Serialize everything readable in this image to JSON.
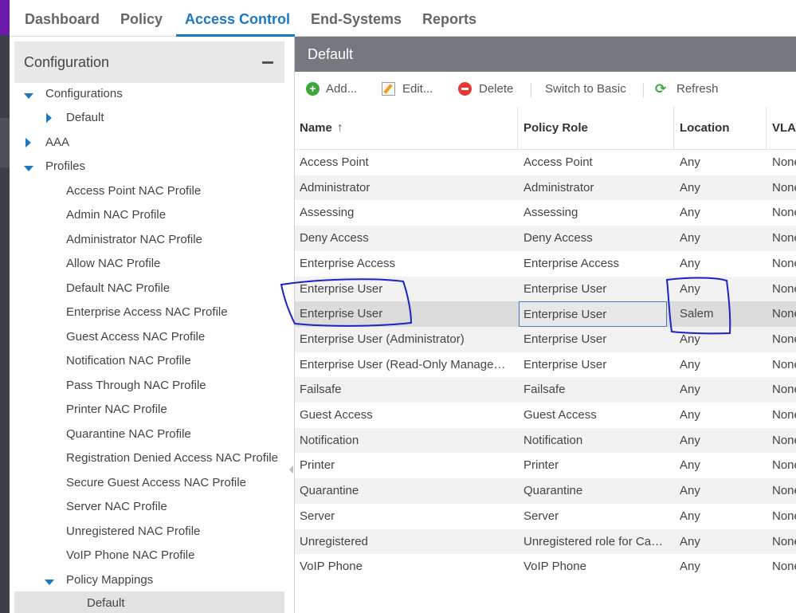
{
  "nav": {
    "tabs": [
      {
        "label": "Dashboard"
      },
      {
        "label": "Policy"
      },
      {
        "label": "Access Control"
      },
      {
        "label": "End-Systems"
      },
      {
        "label": "Reports"
      }
    ],
    "active": "Access Control"
  },
  "sidebar": {
    "title": "Configuration",
    "tree": [
      {
        "label": "Configurations"
      },
      {
        "label": "Default"
      },
      {
        "label": "AAA"
      },
      {
        "label": "Profiles"
      },
      {
        "label": "Access Point NAC Profile"
      },
      {
        "label": "Admin NAC Profile"
      },
      {
        "label": "Administrator NAC Profile"
      },
      {
        "label": "Allow NAC Profile"
      },
      {
        "label": "Default NAC Profile"
      },
      {
        "label": "Enterprise Access NAC Profile"
      },
      {
        "label": "Guest Access NAC Profile"
      },
      {
        "label": "Notification NAC Profile"
      },
      {
        "label": "Pass Through NAC Profile"
      },
      {
        "label": "Printer NAC Profile"
      },
      {
        "label": "Quarantine NAC Profile"
      },
      {
        "label": "Registration Denied Access NAC Profile"
      },
      {
        "label": "Secure Guest Access NAC Profile"
      },
      {
        "label": "Server NAC Profile"
      },
      {
        "label": "Unregistered NAC Profile"
      },
      {
        "label": "VoIP Phone NAC Profile"
      },
      {
        "label": "Policy Mappings"
      },
      {
        "label": "Default"
      }
    ]
  },
  "panel": {
    "title": "Default"
  },
  "toolbar": {
    "add_label": "Add...",
    "edit_label": "Edit...",
    "delete_label": "Delete",
    "switch_label": "Switch to Basic",
    "refresh_label": "Refresh"
  },
  "grid": {
    "columns": [
      {
        "label": "Name"
      },
      {
        "label": "Policy Role"
      },
      {
        "label": "Location"
      },
      {
        "label": "VLAN"
      }
    ],
    "rows": [
      {
        "name": "Access Point",
        "role": "Access Point",
        "location": "Any",
        "vlan": "None"
      },
      {
        "name": "Administrator",
        "role": "Administrator",
        "location": "Any",
        "vlan": "None"
      },
      {
        "name": "Assessing",
        "role": "Assessing",
        "location": "Any",
        "vlan": "None"
      },
      {
        "name": "Deny Access",
        "role": "Deny Access",
        "location": "Any",
        "vlan": "None"
      },
      {
        "name": "Enterprise Access",
        "role": "Enterprise Access",
        "location": "Any",
        "vlan": "None"
      },
      {
        "name": "Enterprise User",
        "role": "Enterprise User",
        "location": "Any",
        "vlan": "None"
      },
      {
        "name": "Enterprise User",
        "role": "Enterprise User",
        "location": "Salem",
        "vlan": "None"
      },
      {
        "name": "Enterprise User (Administrator)",
        "role": "Enterprise User",
        "location": "Any",
        "vlan": "None"
      },
      {
        "name": "Enterprise User (Read-Only Management)",
        "role": "Enterprise User",
        "location": "Any",
        "vlan": "None"
      },
      {
        "name": "Failsafe",
        "role": "Failsafe",
        "location": "Any",
        "vlan": "None"
      },
      {
        "name": "Guest Access",
        "role": "Guest Access",
        "location": "Any",
        "vlan": "None"
      },
      {
        "name": "Notification",
        "role": "Notification",
        "location": "Any",
        "vlan": "None"
      },
      {
        "name": "Printer",
        "role": "Printer",
        "location": "Any",
        "vlan": "None"
      },
      {
        "name": "Quarantine",
        "role": "Quarantine",
        "location": "Any",
        "vlan": "None"
      },
      {
        "name": "Server",
        "role": "Server",
        "location": "Any",
        "vlan": "None"
      },
      {
        "name": "Unregistered",
        "role": "Unregistered role for Captive Portal",
        "location": "Any",
        "vlan": "None"
      },
      {
        "name": "VoIP Phone",
        "role": "VoIP Phone",
        "location": "Any",
        "vlan": "None"
      }
    ]
  },
  "colors": {
    "accent": "#1a78c2",
    "header_bar": "#75797f",
    "annotation": "#1a22c8"
  }
}
